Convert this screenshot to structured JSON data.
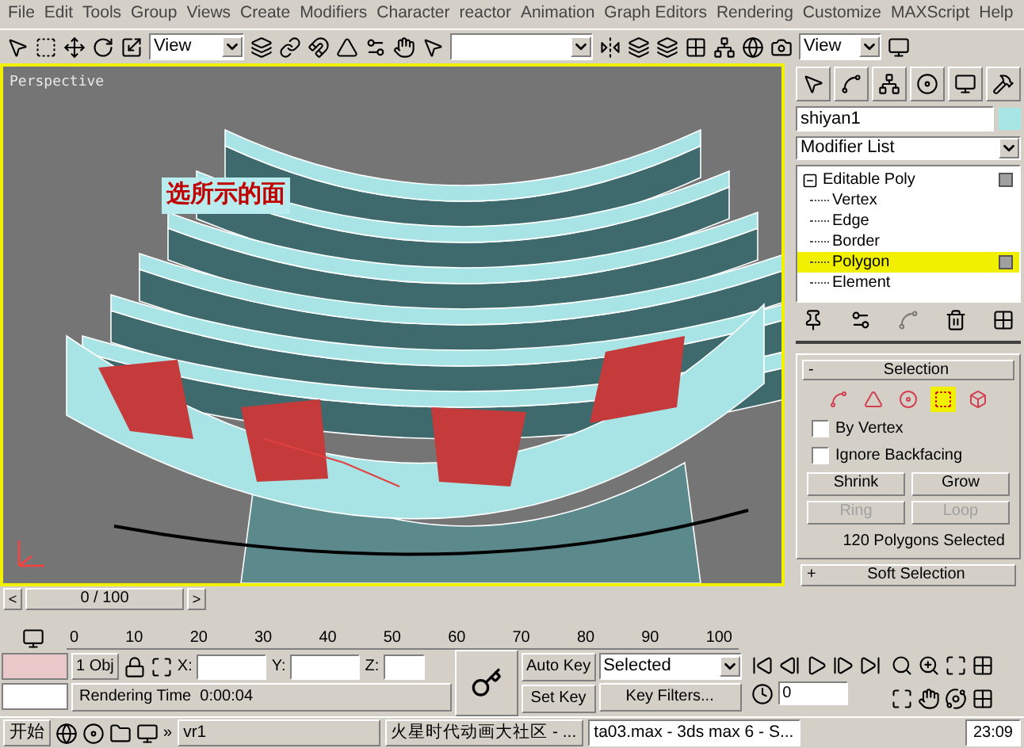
{
  "menu_bar": [
    "File",
    "Edit",
    "Tools",
    "Group",
    "Views",
    "Create",
    "Modifiers",
    "Character",
    "reactor",
    "Animation",
    "Graph Editors",
    "Rendering",
    "Customize",
    "MAXScript",
    "Help"
  ],
  "toolbar": {
    "reference_coord": "View",
    "render_view": "View"
  },
  "viewport": {
    "label": "Perspective",
    "annotation": "选所示的面"
  },
  "command_panel": {
    "object_name": "shiyan1",
    "modifier_list": "Modifier List",
    "stack": [
      {
        "label": "Editable Poly",
        "selected": false,
        "children": [
          {
            "label": "Vertex",
            "selected": false
          },
          {
            "label": "Edge",
            "selected": false
          },
          {
            "label": "Border",
            "selected": false
          },
          {
            "label": "Polygon",
            "selected": true
          },
          {
            "label": "Element",
            "selected": false
          }
        ]
      }
    ],
    "selection_rollout": {
      "toggle": "-",
      "title": "Selection",
      "subobject_levels": [
        {
          "kind": "vertex",
          "selected": false
        },
        {
          "kind": "edge",
          "selected": false
        },
        {
          "kind": "border",
          "selected": false
        },
        {
          "kind": "polygon",
          "selected": true
        },
        {
          "kind": "element",
          "selected": false
        }
      ],
      "checkboxes": [
        {
          "label": "By Vertex",
          "checked": false
        },
        {
          "label": "Ignore Backfacing",
          "checked": false
        }
      ],
      "buttons": [
        {
          "label": "Shrink",
          "disabled": false
        },
        {
          "label": "Grow",
          "disabled": false
        },
        {
          "label": "Ring",
          "disabled": true
        },
        {
          "label": "Loop",
          "disabled": true
        }
      ],
      "status": "120 Polygons Selected"
    },
    "soft_selection_rollout": {
      "toggle": "+",
      "title": "Soft Selection"
    }
  },
  "time_slider": {
    "prev": "<",
    "label": "0 / 100",
    "next": ">"
  },
  "track_bar": {
    "ticks": [
      "0",
      "10",
      "20",
      "30",
      "40",
      "50",
      "60",
      "70",
      "80",
      "90",
      "100"
    ]
  },
  "status_bar": {
    "selection": "1 Obj",
    "x_label": "X:",
    "y_label": "Y:",
    "z_label": "Z:",
    "prompt": "Rendering Time  0:00:04"
  },
  "animation": {
    "auto_key": "Auto Key",
    "set_key": "Set Key",
    "key_mode": "Selected",
    "key_filters": "Key Filters...",
    "frame": "0"
  },
  "taskbar": {
    "start": "开始",
    "more": "»",
    "tasks": [
      {
        "label": "vr1",
        "selected": false
      },
      {
        "label": "火星时代动画大社区 - ...",
        "selected": false
      },
      {
        "label": "ta03.max - 3ds max 6 - S...",
        "selected": true
      }
    ],
    "clock": "23:09"
  }
}
